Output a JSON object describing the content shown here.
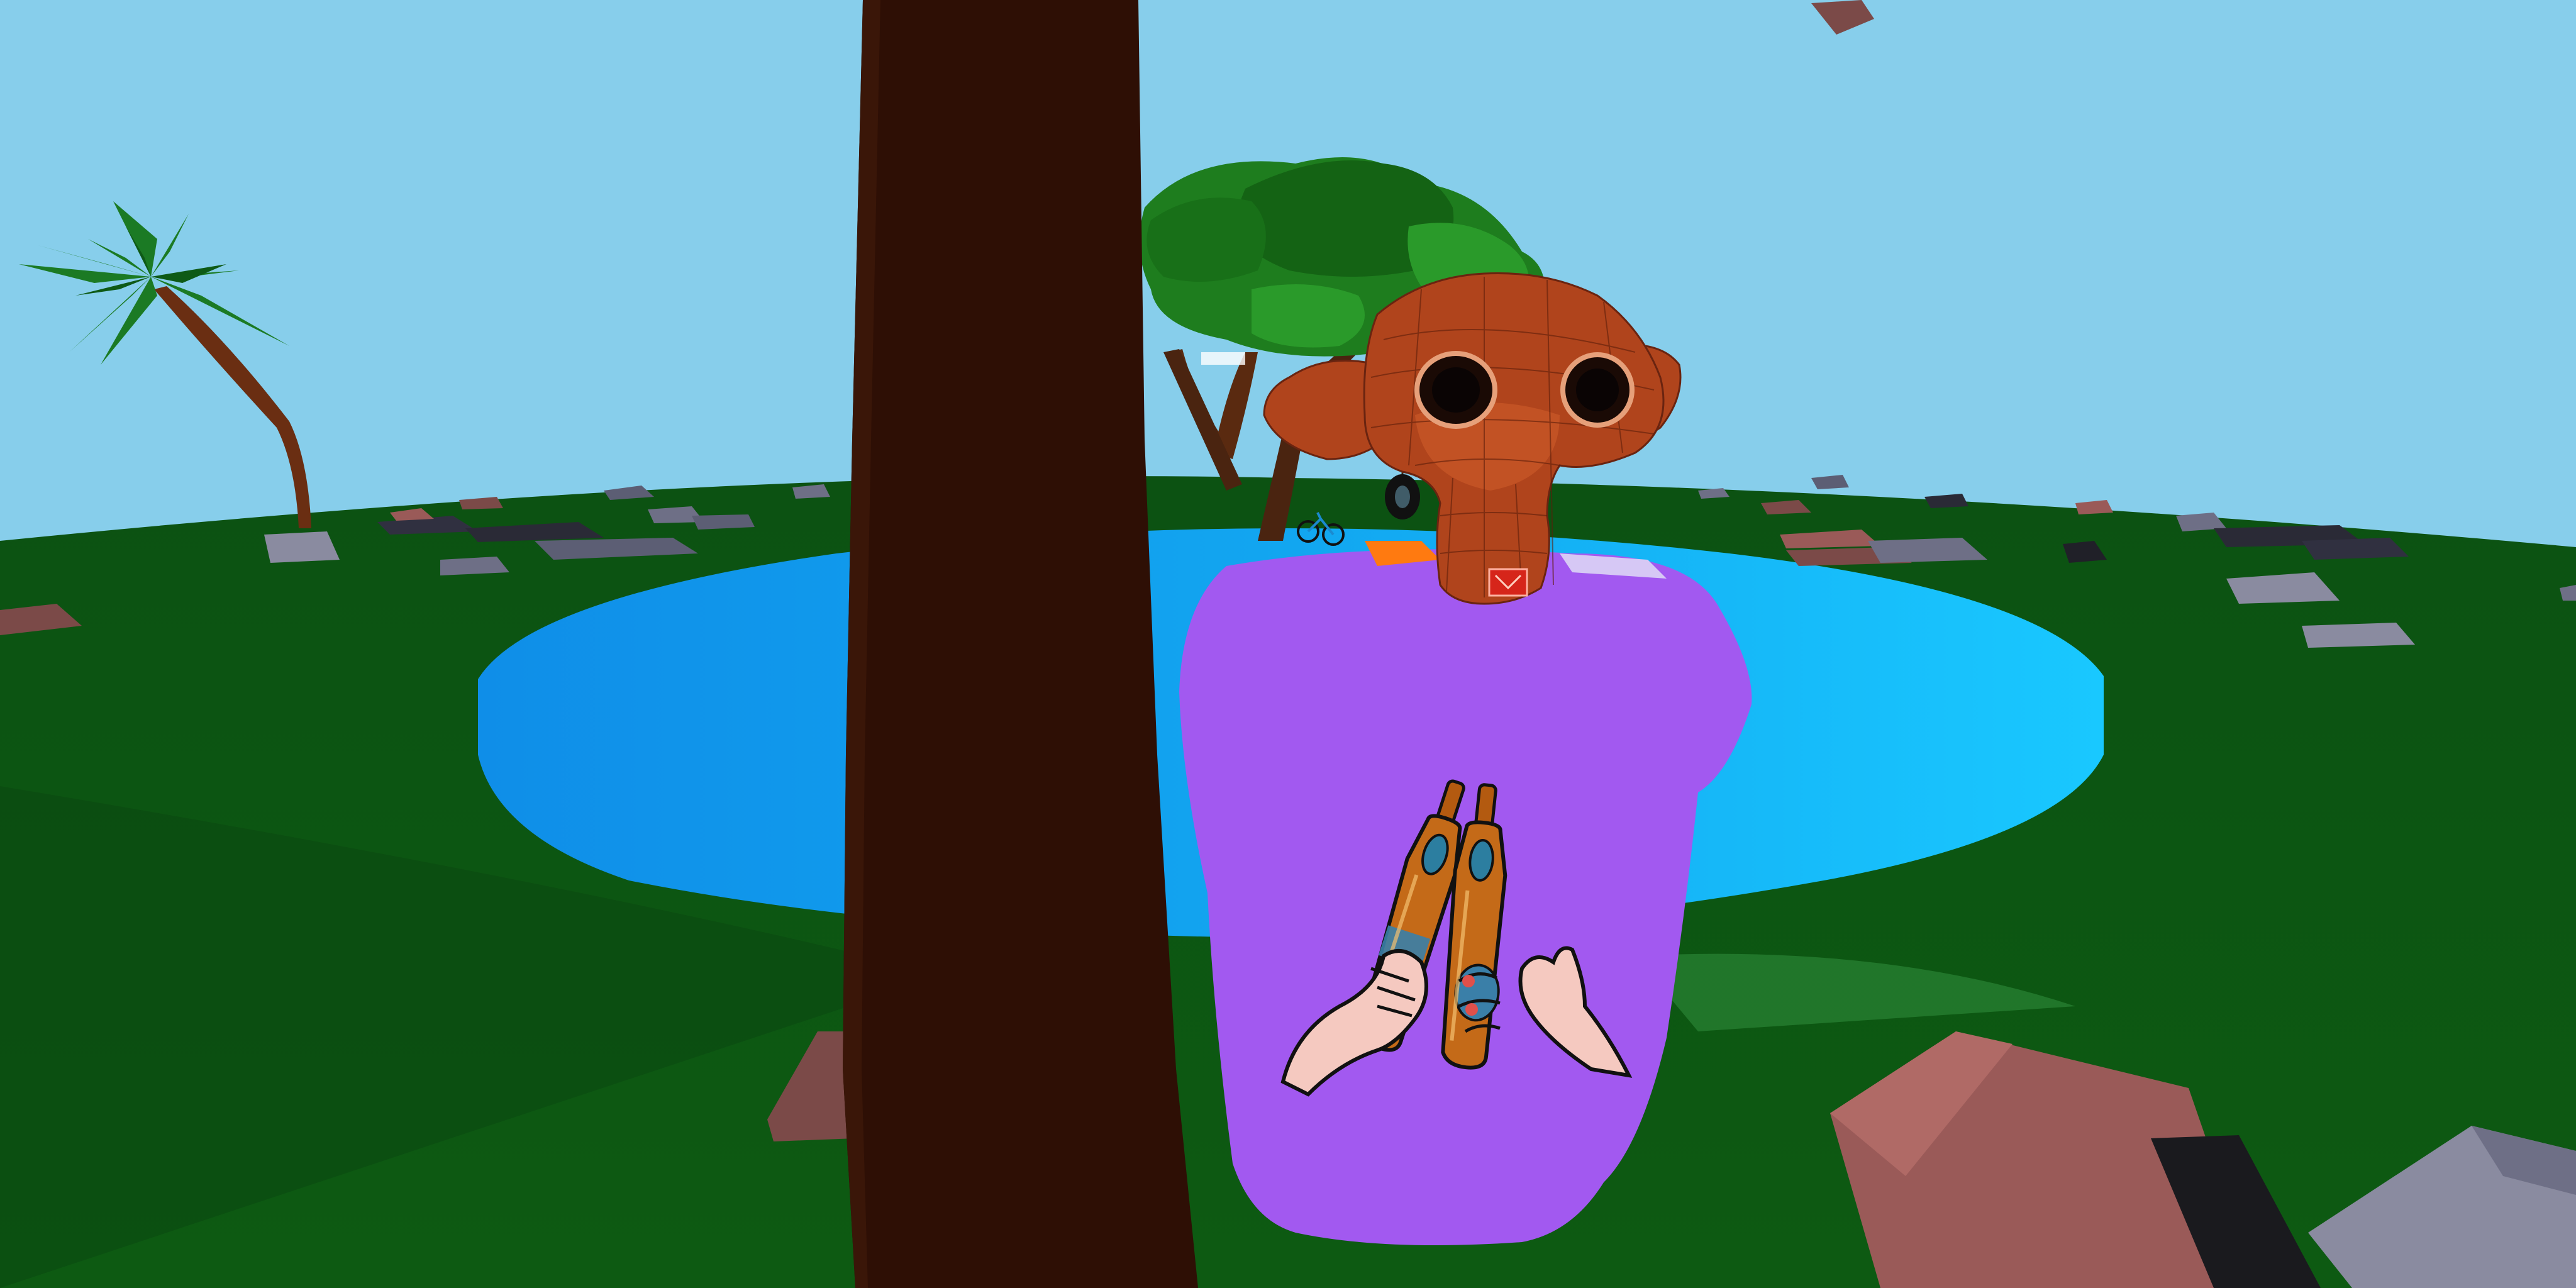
{
  "scene": {
    "type": "3d-game-viewport",
    "colors": {
      "sky": "#87CEEB",
      "grass": "#0E5A14",
      "grass_dark": "#0A4510",
      "water": "#12A6F0",
      "water_light": "#19C3FF",
      "trunk": "#2E0F05",
      "shirt": "#A259F0",
      "monkey_head": "#B0441C",
      "rock_gray": "#6E6F86",
      "rock_pink": "#9A5A58",
      "tree_green": "#1E7D1E"
    },
    "objects": [
      "sky",
      "ground",
      "pond",
      "palm-tree",
      "background-tree",
      "tree-trunk",
      "avatar-body",
      "shirt-print-bottles",
      "monkey-head",
      "rocks",
      "tire-swing",
      "bicycle"
    ]
  }
}
